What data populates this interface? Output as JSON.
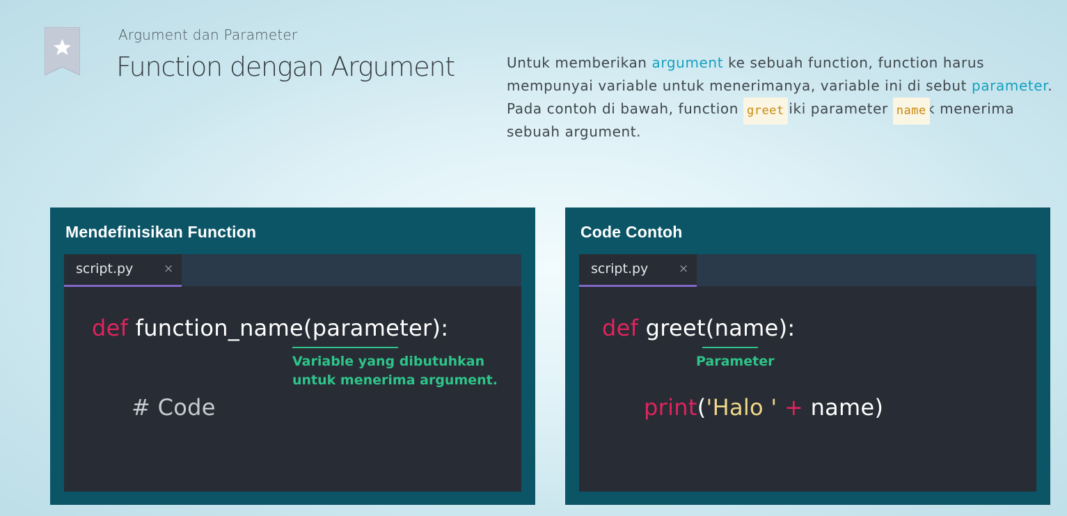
{
  "header": {
    "subtitle": "Argument dan Parameter",
    "title": "Function dengan Argument"
  },
  "description": {
    "p1": "Untuk memberikan ",
    "term1": "argument",
    "p2": " ke sebuah function, function harus mempunyai variable untuk menerimanya, variable ini di sebut ",
    "term2": "parameter",
    "p3": ". Pada contoh di bawah, function ",
    "code1": "greet",
    "p4": " memiliki parameter ",
    "code2": "name",
    "p5": " untuk menerima sebuah argument."
  },
  "left_panel": {
    "title": "Mendefinisikan Function",
    "tab_name": "script.py",
    "tab_close": "×",
    "code_line1_keyword": "def",
    "code_line1_rest": "function_name(parameter):",
    "note": "Variable yang dibutuhkan\nuntuk menerima argument.",
    "code_line2": "# Code"
  },
  "right_panel": {
    "title": "Code Contoh",
    "tab_name": "script.py",
    "tab_close": "×",
    "code_line1_keyword": "def",
    "code_line1_rest": "greet(name):",
    "note": "Parameter",
    "code_line2_fn": "print",
    "code_line2_open": "(",
    "code_line2_str": "'Halo '",
    "code_line2_op": " + ",
    "code_line2_rest": "name)"
  },
  "icons": {
    "bookmark": "bookmark-star-icon",
    "close": "close-icon"
  },
  "colors": {
    "panel_bg": "#0c5566",
    "editor_bg": "#282c34",
    "keyword": "#e0245e",
    "annotation": "#2ec48a",
    "tab_accent": "#8068c8",
    "link": "#14a0c0"
  }
}
